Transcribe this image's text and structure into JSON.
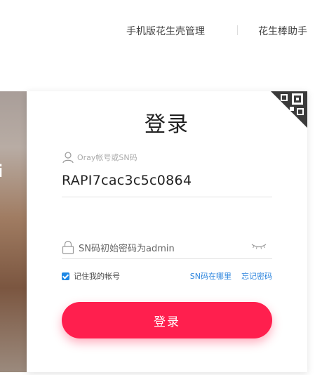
{
  "topnav": {
    "link1": "手机版花生壳管理",
    "link2": "花生棒助手"
  },
  "background": {
    "glyph": "i"
  },
  "card": {
    "title": "登录",
    "account": {
      "label": "Oray帐号或SN码",
      "value": "RAPI7cac3c5c0864"
    },
    "password": {
      "placeholder": "SN码初始密码为admin"
    },
    "remember_label": "记住我的帐号",
    "remember_checked": true,
    "links": {
      "where_sn": "SN码在哪里",
      "forgot": "忘记密码"
    },
    "login_button": "登录"
  },
  "colors": {
    "accent": "#ff1f4e",
    "link": "#2e86de",
    "checkbox": "#1e88e5"
  },
  "icons": [
    "user-icon",
    "lock-icon",
    "eye-closed-icon",
    "qr-code-icon"
  ]
}
